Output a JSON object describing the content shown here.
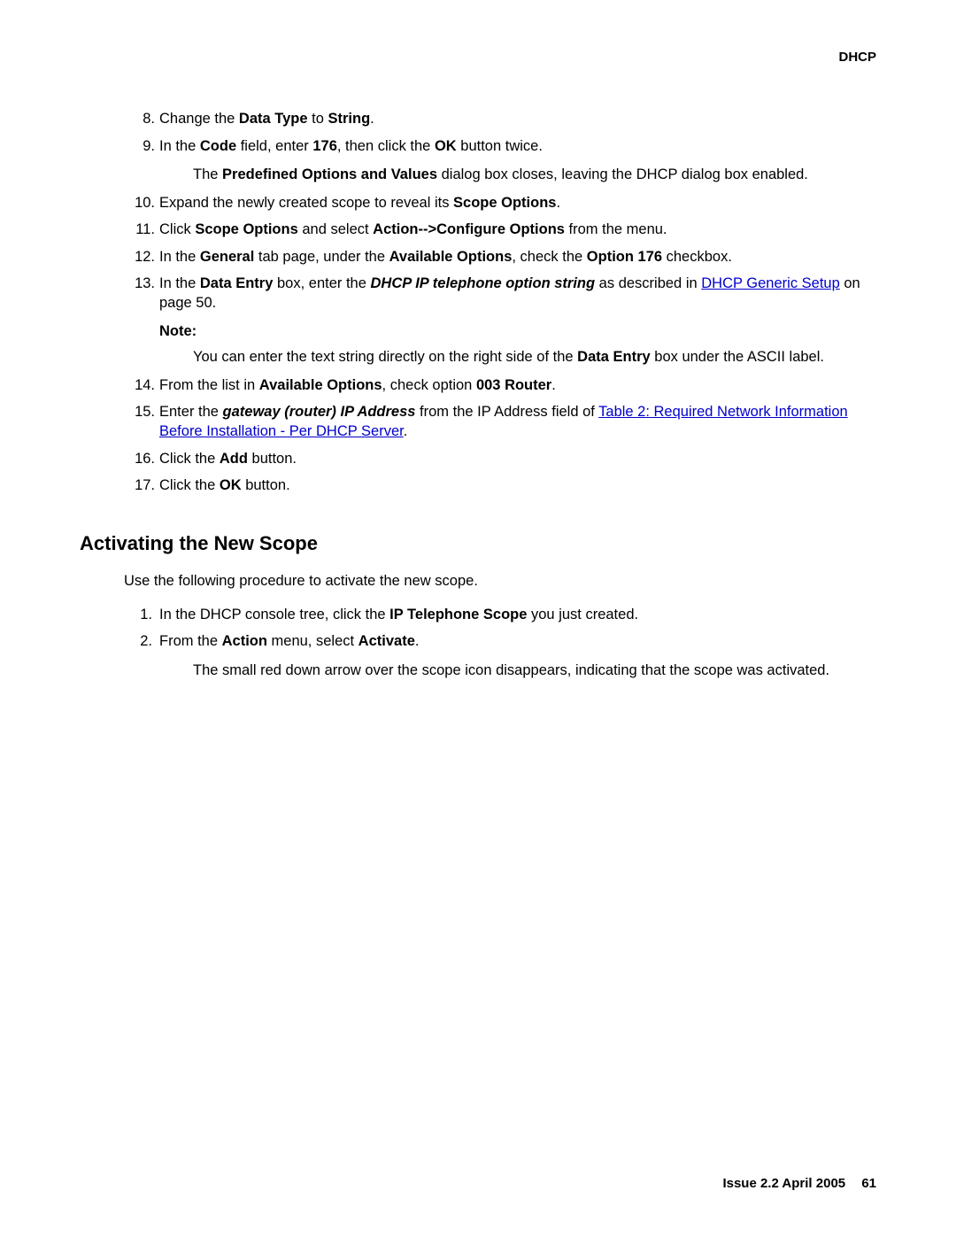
{
  "header": "DHCP",
  "items1": [
    {
      "num": "8.",
      "html": "Change the <b>Data Type</b> to <b>String</b>."
    },
    {
      "num": "9.",
      "html": "In the <b>Code</b> field, enter <b>176</b>, then click the <b>OK</b> button twice.",
      "sub": "The <b>Predefined Options and Values</b> dialog box closes, leaving the DHCP dialog box enabled."
    },
    {
      "num": "10.",
      "html": "Expand the newly created scope to reveal its <b>Scope Options</b>."
    },
    {
      "num": "11.",
      "html": "Click <b>Scope Options</b> and select <b>Action--&gt;Configure Options</b> from the menu."
    },
    {
      "num": "12.",
      "html": "In the <b>General</b> tab page, under the <b>Available Options</b>, check the <b>Option 176</b> checkbox."
    },
    {
      "num": "13.",
      "html": "In the <b>Data Entry</b> box, enter the <span class=\"bi\">DHCP IP telephone option string</span> as described in <a class=\"link\" href=\"#\" data-name=\"link-dhcp-generic-setup\" data-interactable=\"true\">DHCP Generic Setup</a> on page 50.",
      "note_label": "Note:",
      "note_text": "You can enter the text string directly on the right side of the <b>Data Entry</b> box under the ASCII label."
    },
    {
      "num": "14.",
      "html": "From the list in <b>Available Options</b>, check option <b>003 Router</b>."
    },
    {
      "num": "15.",
      "html": "Enter the <span class=\"bi\">gateway (router) IP Address</span> from the IP Address field of <a class=\"link\" href=\"#\" data-name=\"link-table2\" data-interactable=\"true\">Table 2:  Required Network Information Before Installation - Per DHCP Server</a>."
    },
    {
      "num": "16.",
      "html": "Click the <b>Add</b> button."
    },
    {
      "num": "17.",
      "html": "Click the <b>OK</b> button."
    }
  ],
  "section_heading": "Activating the New Scope",
  "section_intro": "Use the following procedure to activate the new scope.",
  "items2": [
    {
      "num": "1.",
      "html": "In the DHCP console tree, click the <b>IP Telephone Scope</b> you just created."
    },
    {
      "num": "2.",
      "html": "From the <b>Action</b> menu, select <b>Activate</b>.",
      "sub": "The small red down arrow over the scope icon disappears, indicating that the scope was activated."
    }
  ],
  "footer_text": "Issue 2.2   April 2005",
  "footer_page": "61"
}
